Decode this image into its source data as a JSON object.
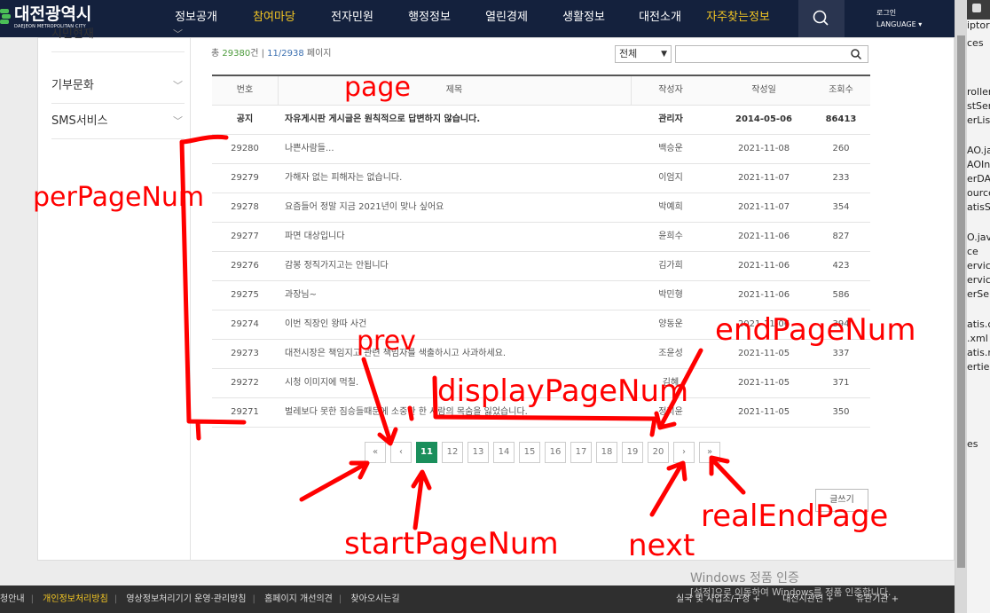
{
  "header": {
    "logo_title": "대전광역시",
    "logo_sub": "DAEJEON METROPOLITAN CITY",
    "nav": [
      {
        "label": "정보공개",
        "active": false
      },
      {
        "label": "참여마당",
        "active": true
      },
      {
        "label": "전자민원",
        "active": false
      },
      {
        "label": "행정정보",
        "active": false
      },
      {
        "label": "열린경제",
        "active": false
      },
      {
        "label": "생활정보",
        "active": false
      },
      {
        "label": "대전소개",
        "active": false
      },
      {
        "label": "자주찾는정보",
        "active": true
      }
    ],
    "login": "로그인",
    "language": "LANGUAGE"
  },
  "sidebar": {
    "items": [
      {
        "label": "시민현재"
      },
      {
        "label": "기부문화"
      },
      {
        "label": "SMS서비스"
      }
    ]
  },
  "board": {
    "total_prefix": "총",
    "total_count": "29380",
    "total_unit": "건",
    "page_info": "11/2938",
    "page_unit": "페이지",
    "select_value": "전체",
    "columns": {
      "no": "번호",
      "title": "제목",
      "writer": "작성자",
      "date": "작성일",
      "views": "조회수"
    },
    "rows": [
      {
        "no": "공지",
        "title": "자유게시판 게시글은 원칙적으로 답변하지 않습니다.",
        "writer": "관리자",
        "date": "2014-05-06",
        "views": "86413"
      },
      {
        "no": "29280",
        "title": "나쁜사람들...",
        "writer": "백승운",
        "date": "2021-11-08",
        "views": "260"
      },
      {
        "no": "29279",
        "title": "가해자 없는 피해자는 없습니다.",
        "writer": "이엄지",
        "date": "2021-11-07",
        "views": "233"
      },
      {
        "no": "29278",
        "title": "요즘들어 정말 지금 2021년이 맞나 싶어요",
        "writer": "박예희",
        "date": "2021-11-07",
        "views": "354"
      },
      {
        "no": "29277",
        "title": "파면 대상입니다",
        "writer": "윤희수",
        "date": "2021-11-06",
        "views": "827"
      },
      {
        "no": "29276",
        "title": "감봉 정직가지고는 안됩니다",
        "writer": "김가희",
        "date": "2021-11-06",
        "views": "423"
      },
      {
        "no": "29275",
        "title": "과장님~",
        "writer": "박민형",
        "date": "2021-11-06",
        "views": "586"
      },
      {
        "no": "29274",
        "title": "이번 직장인 왕따 사건",
        "writer": "양동운",
        "date": "2021-11-06",
        "views": "394"
      },
      {
        "no": "29273",
        "title": "대전시장은 책임지고 관련 책임자를 색출하시고 사과하세요.",
        "writer": "조윤성",
        "date": "2021-11-05",
        "views": "337"
      },
      {
        "no": "29272",
        "title": "시청 이미지에 먹칠.",
        "writer": "김혜",
        "date": "2021-11-05",
        "views": "371"
      },
      {
        "no": "29271",
        "title": "벌레보다 못한 짐승들때문에 소중한 한 사람의 목숨을 잃었습니다.",
        "writer": "정지윤",
        "date": "2021-11-05",
        "views": "350"
      }
    ],
    "pager": {
      "first": "«",
      "prev": "‹",
      "pages": [
        "11",
        "12",
        "13",
        "14",
        "15",
        "16",
        "17",
        "18",
        "19",
        "20"
      ],
      "current": "11",
      "next": "›",
      "last": "»"
    },
    "write_label": "글쓰기"
  },
  "annotations": {
    "page": "page",
    "perPageNum": "perPageNum",
    "prev": "prev",
    "endPageNum": "endPageNum",
    "displayPageNum": "displayPageNum",
    "realEndPage": "realEndPage",
    "startPageNum": "startPageNum",
    "next": "next"
  },
  "footer": {
    "links": [
      "청안내",
      "개인정보처리방침",
      "영상정보처리기기 운영·관리방침",
      "홈페이지 개선의견",
      "찾아오시는길"
    ],
    "right_links": [
      "실국 및 사업소/구청 +",
      "대전시관련 +",
      "유관기관 +"
    ]
  },
  "watermark": {
    "line1": "Windows 정품 인증",
    "line2": "[설정]으로 이동하여 Windows를 정품 인증합니다."
  },
  "ide": {
    "lines": [
      "iptor:",
      "ces",
      "roller",
      "stSer",
      "erList",
      "AO.ja",
      "AOIn",
      "erDA",
      "ource",
      "atisS",
      "O.jav",
      "ce",
      "ervice",
      "ervice",
      "erSer",
      "atis.c",
      ".xml",
      "atis.n",
      "erties",
      "es"
    ]
  },
  "colors": {
    "header_bg": "#14213d",
    "accent_yellow": "#f3c623",
    "active_page": "#1a8f5c",
    "annotation_red": "#ff0000"
  }
}
